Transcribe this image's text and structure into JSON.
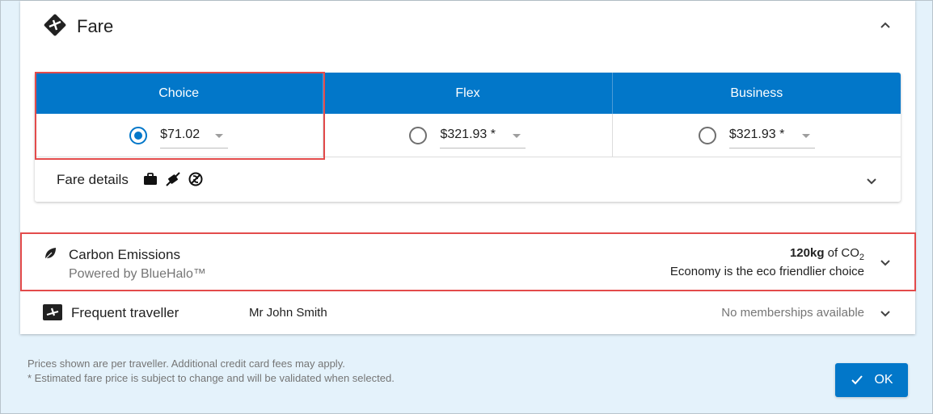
{
  "fare_section": {
    "title": "Fare",
    "icon": "ticket-plane-icon",
    "collapse_icon": "chevron-up-icon"
  },
  "fare_table": {
    "tabs": [
      {
        "label": "Choice"
      },
      {
        "label": "Flex"
      },
      {
        "label": "Business"
      }
    ],
    "options": [
      {
        "price": "$71.02",
        "selected": true
      },
      {
        "price": "$321.93 *",
        "selected": false
      },
      {
        "price": "$321.93 *",
        "selected": false
      }
    ],
    "details_label": "Fare details",
    "details_icons": [
      "briefcase-icon",
      "no-checked-bag-icon",
      "no-change-icon"
    ]
  },
  "carbon": {
    "title": "Carbon Emissions",
    "subtitle": "Powered by BlueHalo™",
    "amount_value": "120kg",
    "amount_suffix": " of CO",
    "amount_sub": "2",
    "note": "Economy is the eco friendlier choice"
  },
  "frequent": {
    "title": "Frequent traveller",
    "name": "Mr John Smith",
    "status": "No memberships available"
  },
  "footnotes": {
    "line1": "Prices shown are per traveller. Additional credit card fees may apply.",
    "line2": "* Estimated fare price is subject to change and will be validated when selected."
  },
  "ok_button": {
    "label": "OK"
  },
  "colors": {
    "accent": "#0277c9",
    "highlight": "#e34b4b",
    "page_bg": "#e4f2fb"
  }
}
